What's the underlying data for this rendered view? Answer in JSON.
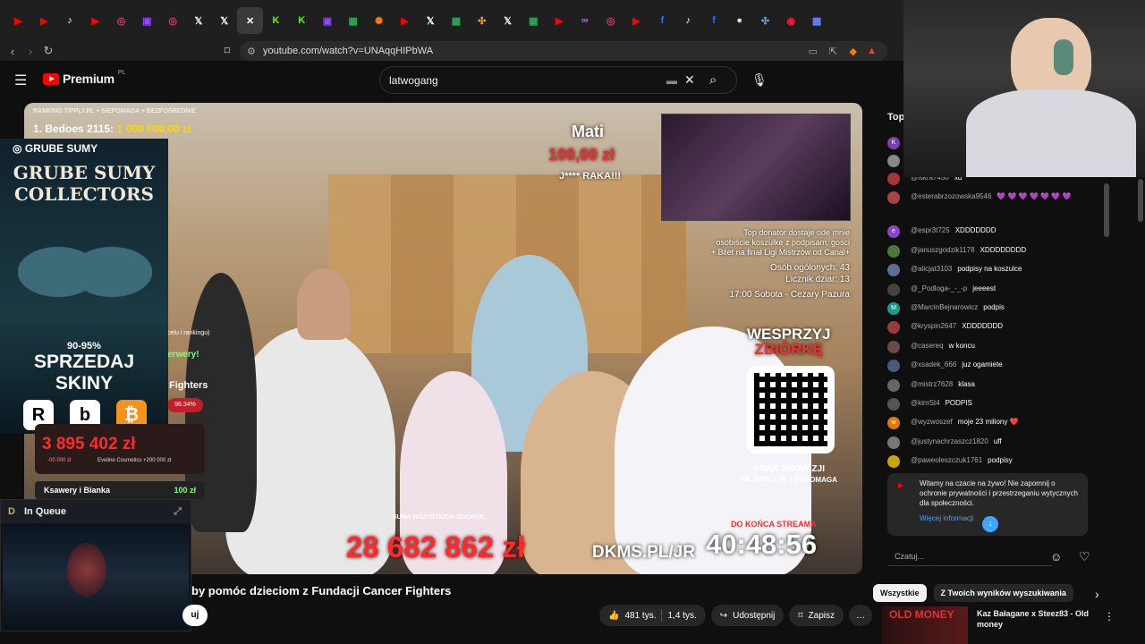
{
  "browser": {
    "tabs": [
      {
        "icon": "youtube-icon",
        "glyph": "▶",
        "color": "#ff0000"
      },
      {
        "icon": "youtube-icon",
        "glyph": "▶",
        "color": "#ff0000"
      },
      {
        "icon": "tiktok-icon",
        "glyph": "♪",
        "color": "#ffffff"
      },
      {
        "icon": "youtube-icon",
        "glyph": "▶",
        "color": "#ff0000"
      },
      {
        "icon": "instagram-icon",
        "glyph": "◎",
        "color": "#e1306c"
      },
      {
        "icon": "twitch-icon",
        "glyph": "▣",
        "color": "#9146ff"
      },
      {
        "icon": "instagram-icon",
        "glyph": "◎",
        "color": "#e1306c"
      },
      {
        "icon": "x-icon",
        "glyph": "𝕏",
        "color": "#ffffff"
      },
      {
        "icon": "x-icon",
        "glyph": "𝕏",
        "color": "#ffffff"
      },
      {
        "icon": "close-icon",
        "glyph": "✕",
        "color": "#ffffff"
      },
      {
        "icon": "kick-icon",
        "glyph": "K",
        "color": "#53fc18"
      },
      {
        "icon": "kick-icon",
        "glyph": "K",
        "color": "#53fc18"
      },
      {
        "icon": "twitch-icon",
        "glyph": "▣",
        "color": "#9146ff"
      },
      {
        "icon": "sheet-icon",
        "glyph": "▦",
        "color": "#34a853"
      },
      {
        "icon": "flame-icon",
        "glyph": "✺",
        "color": "#ff7a00"
      },
      {
        "icon": "youtube-icon",
        "glyph": "▶",
        "color": "#ff0000"
      },
      {
        "icon": "x-icon",
        "glyph": "𝕏",
        "color": "#ffffff"
      },
      {
        "icon": "sheet-icon",
        "glyph": "▦",
        "color": "#34a853"
      },
      {
        "icon": "slack-icon",
        "glyph": "✣",
        "color": "#e8a33b"
      },
      {
        "icon": "x-icon",
        "glyph": "𝕏",
        "color": "#ffffff"
      },
      {
        "icon": "sheet-icon",
        "glyph": "▦",
        "color": "#34a853"
      },
      {
        "icon": "youtube-icon",
        "glyph": "▶",
        "color": "#ff0000"
      },
      {
        "icon": "link-icon",
        "glyph": "∞",
        "color": "#b36bff"
      },
      {
        "icon": "instagram-icon",
        "glyph": "◎",
        "color": "#e1306c"
      },
      {
        "icon": "youtube-icon",
        "glyph": "▶",
        "color": "#ff0000"
      },
      {
        "icon": "facebook-icon",
        "glyph": "f",
        "color": "#1877f2"
      },
      {
        "icon": "tiktok-icon",
        "glyph": "♪",
        "color": "#ffffff"
      },
      {
        "icon": "facebook-icon",
        "glyph": "f",
        "color": "#1877f2"
      },
      {
        "icon": "github-icon",
        "glyph": "●",
        "color": "#dddddd"
      },
      {
        "icon": "slack-icon",
        "glyph": "✣",
        "color": "#6a9fd8"
      },
      {
        "icon": "opera-icon",
        "glyph": "◉",
        "color": "#ff1b2d"
      },
      {
        "icon": "app-icon",
        "glyph": "▩",
        "color": "#6a7fff"
      }
    ],
    "url": "youtube.com/watch?v=UNAqqHIPbWA"
  },
  "youtube": {
    "logo_text": "Premium",
    "logo_region": "PL",
    "search_value": "latwogang"
  },
  "stream": {
    "ranking_header": "RANKING TIPPLY.PL + SIEPOMAGA + BEZPOŚREDNIE",
    "ranking_first_name": "1. Bedoes 2115:",
    "ranking_first_amount": "1 000 000,00 zł",
    "donor_name": "Mati",
    "donor_amount": "100,00 zł",
    "donor_message": "J**** RAKA!!!",
    "info_line1": "Top donator dostaje ode mnie",
    "info_line2": "osobiście koszulke z podpisam. gości",
    "info_line3": "+ Bilet na finał Ligi Mistrzów od Canal+",
    "people_total": "Osób ogólonych: 43",
    "counter": "Licznik dziar: 13",
    "schedule": "17:00 Sobota - Cezary Pazura",
    "support_line1": "WESPRZYJ",
    "support_line2": "ZBIÓRKĘ",
    "no_fee_line1": "BRAK PROWIZJI",
    "no_fee_line2": "NA TIPPLY.PL I SIEPOMAGA",
    "sum_label": "SUMA WSZYSTKICH ZBIÓREK:",
    "sum_amount": "28 682 862 zł",
    "dkms": "DKMS.PL/JR",
    "countdown_label": "DO KOŃCA STREAMA",
    "countdown": "40:48:56",
    "partial_fighters": "Fighters",
    "partial_pct": "96.34%",
    "partial_werwery": "erwery!",
    "partial_rankingu": "celu i rankingu)"
  },
  "left_overlay": {
    "tag": "GRUBE SUMY",
    "title_line1": "GRUBE SUMY",
    "title_line2": "COLLECTORS",
    "percent": "90-95%",
    "sell_line1": "SPRZEDAJ",
    "sell_line2": "SKINY",
    "icons": [
      {
        "name": "roobet-icon",
        "glyph": "R",
        "bg": "#ffffff",
        "fg": "#000000"
      },
      {
        "name": "bitskins-icon",
        "glyph": "b",
        "bg": "#ffffff",
        "fg": "#000000"
      },
      {
        "name": "bitcoin-icon",
        "glyph": "₿",
        "bg": "#f7931a",
        "fg": "#ffffff"
      }
    ],
    "big_amount": "3 895 402 zł",
    "small_left": "-00 000 zł",
    "small_right": "Eveline Cosmetics +200 000 zł",
    "donor_row_name": "Ksawery i Bianka",
    "donor_row_amount": "100 zł",
    "queue_title": "In Queue"
  },
  "video": {
    "title_partial": "by pomóc dzieciom z Fundacji Cancer Fighters",
    "likes": "481 tys.",
    "comments": "1,4 tys.",
    "share": "Udostępnij",
    "save": "Zapisz"
  },
  "chat": {
    "header": "Top",
    "messages": [
      {
        "avatar_letter": "K",
        "avatar_color": "#7b3fb5",
        "user": "",
        "text": ""
      },
      {
        "avatar_letter": "",
        "avatar_color": "#888888",
        "user": "",
        "text": ""
      },
      {
        "avatar_letter": "",
        "avatar_color": "#aa3333",
        "user": "@iskra7450",
        "text": "xd"
      },
      {
        "avatar_letter": "",
        "avatar_color": "#aa4444",
        "user": "@esterabrzozowska9546",
        "text": "💜 💜 💜 💜 💜 💜 💜"
      },
      {
        "avatar_letter": "e",
        "avatar_color": "#8a45c9",
        "user": "@espr3t725",
        "text": "XDDDDDDD"
      },
      {
        "avatar_letter": "",
        "avatar_color": "#4a7a3a",
        "user": "@januszgodzik1178",
        "text": "XDDDDDDDD"
      },
      {
        "avatar_letter": "",
        "avatar_color": "#5c6f99",
        "user": "@alicjat3103",
        "text": "podpisy na koszulce"
      },
      {
        "avatar_letter": "",
        "avatar_color": "#444444",
        "user": "@_Podloga-_-_-p",
        "text": "jeeeest"
      },
      {
        "avatar_letter": "M",
        "avatar_color": "#1a9d8a",
        "user": "@MarcinBejnarowicz",
        "text": "podpis"
      },
      {
        "avatar_letter": "",
        "avatar_color": "#9a3b3b",
        "user": "@kryspin2647",
        "text": "XDDDDDDD"
      },
      {
        "avatar_letter": "",
        "avatar_color": "#6a4a4a",
        "user": "@casereq",
        "text": "w koncu"
      },
      {
        "avatar_letter": "",
        "avatar_color": "#4a5a7a",
        "user": "@xsadek_666",
        "text": "juz ogamiete"
      },
      {
        "avatar_letter": "",
        "avatar_color": "#666666",
        "user": "@mistrz7628",
        "text": "klasa"
      },
      {
        "avatar_letter": "",
        "avatar_color": "#555555",
        "user": "@kimSt4",
        "text": "PODPIS"
      },
      {
        "avatar_letter": "w",
        "avatar_color": "#e07b00",
        "user": "@wyzwoszef",
        "text": "moje 23 miliony ❤️"
      },
      {
        "avatar_letter": "",
        "avatar_color": "#777777",
        "user": "@justynachrzaszcz1820",
        "text": "uff"
      },
      {
        "avatar_letter": "",
        "avatar_color": "#c9a500",
        "user": "@paweoleszczuk1761",
        "text": "podpisy"
      }
    ],
    "notice_text": "Witamy na czacie na żywo! Nie zapomnij o ochronie prywatności i przestrzeganiu wytycznych dla społeczności.",
    "notice_link": "Więcej informacji",
    "input_placeholder": "Czatuj..."
  },
  "recommendations": {
    "chips": [
      "Wszystkie",
      "Z Twoich wyników wyszukiwania"
    ],
    "first_title": "Kaz Bałagane x Steez83 - Old money",
    "first_thumb_text": "OLD MONEY"
  }
}
